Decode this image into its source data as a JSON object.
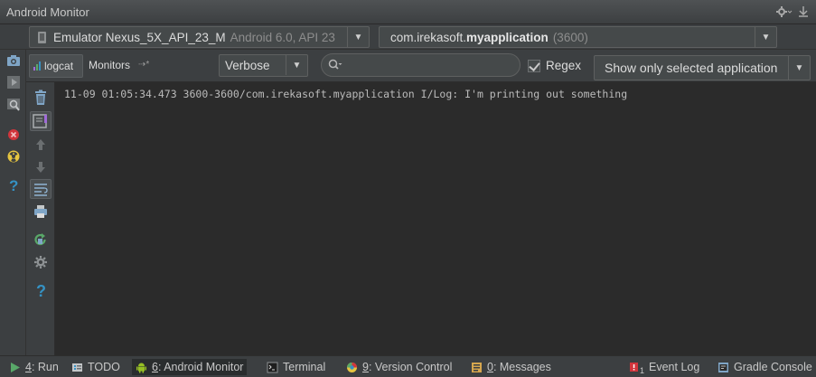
{
  "window": {
    "title": "Android Monitor"
  },
  "device_bar": {
    "device_name": "Emulator Nexus_5X_API_23_M",
    "device_os": "Android 6.0, API 23",
    "process_prefix": "com.irekasoft.",
    "process_bold": "myapplication",
    "process_pid": "(3600)"
  },
  "tabs": [
    {
      "label": "logcat",
      "selected": true
    },
    {
      "label": "Monitors",
      "selected": false
    }
  ],
  "filter_bar": {
    "log_level": "Verbose",
    "search_value": "",
    "search_placeholder": "",
    "regex_label": "Regex",
    "regex_checked": true,
    "app_filter": "Show only selected application"
  },
  "log_lines": [
    "11-09 01:05:34.473 3600-3600/com.irekasoft.myapplication I/Log: I'm printing out something"
  ],
  "bottom_bar": {
    "run": {
      "key": "4",
      "label": ": Run"
    },
    "todo": {
      "label": "TODO"
    },
    "android_monitor": {
      "key": "6",
      "label": ": Android Monitor"
    },
    "terminal": {
      "label": "Terminal"
    },
    "version_control": {
      "key": "9",
      "label": ": Version Control"
    },
    "messages": {
      "key": "0",
      "label": ": Messages"
    },
    "event_log": {
      "badge": "1",
      "label": "Event Log"
    },
    "gradle_console": {
      "label": "Gradle Console"
    }
  },
  "colors": {
    "background": "#2b2b2b",
    "panel": "#3c3f41",
    "accent_blue": "#3592c4",
    "run_green": "#59a869",
    "error_red": "#d1353c",
    "warning_yellow": "#e6c540"
  },
  "icons": {
    "title_bar": [
      "gear-icon",
      "hide-panel-icon"
    ],
    "left_strip": [
      "camera-icon",
      "screen-record-icon",
      "hierarchy-view-icon",
      "terminate-icon",
      "dump-heap-icon",
      "help-icon"
    ],
    "logcat_toolbar": [
      "clear-logcat-icon",
      "scroll-to-end-icon",
      "up-stack-trace-icon",
      "down-stack-trace-icon",
      "use-soft-wraps-icon",
      "print-icon",
      "restart-icon",
      "settings-icon",
      "help-icon"
    ]
  }
}
